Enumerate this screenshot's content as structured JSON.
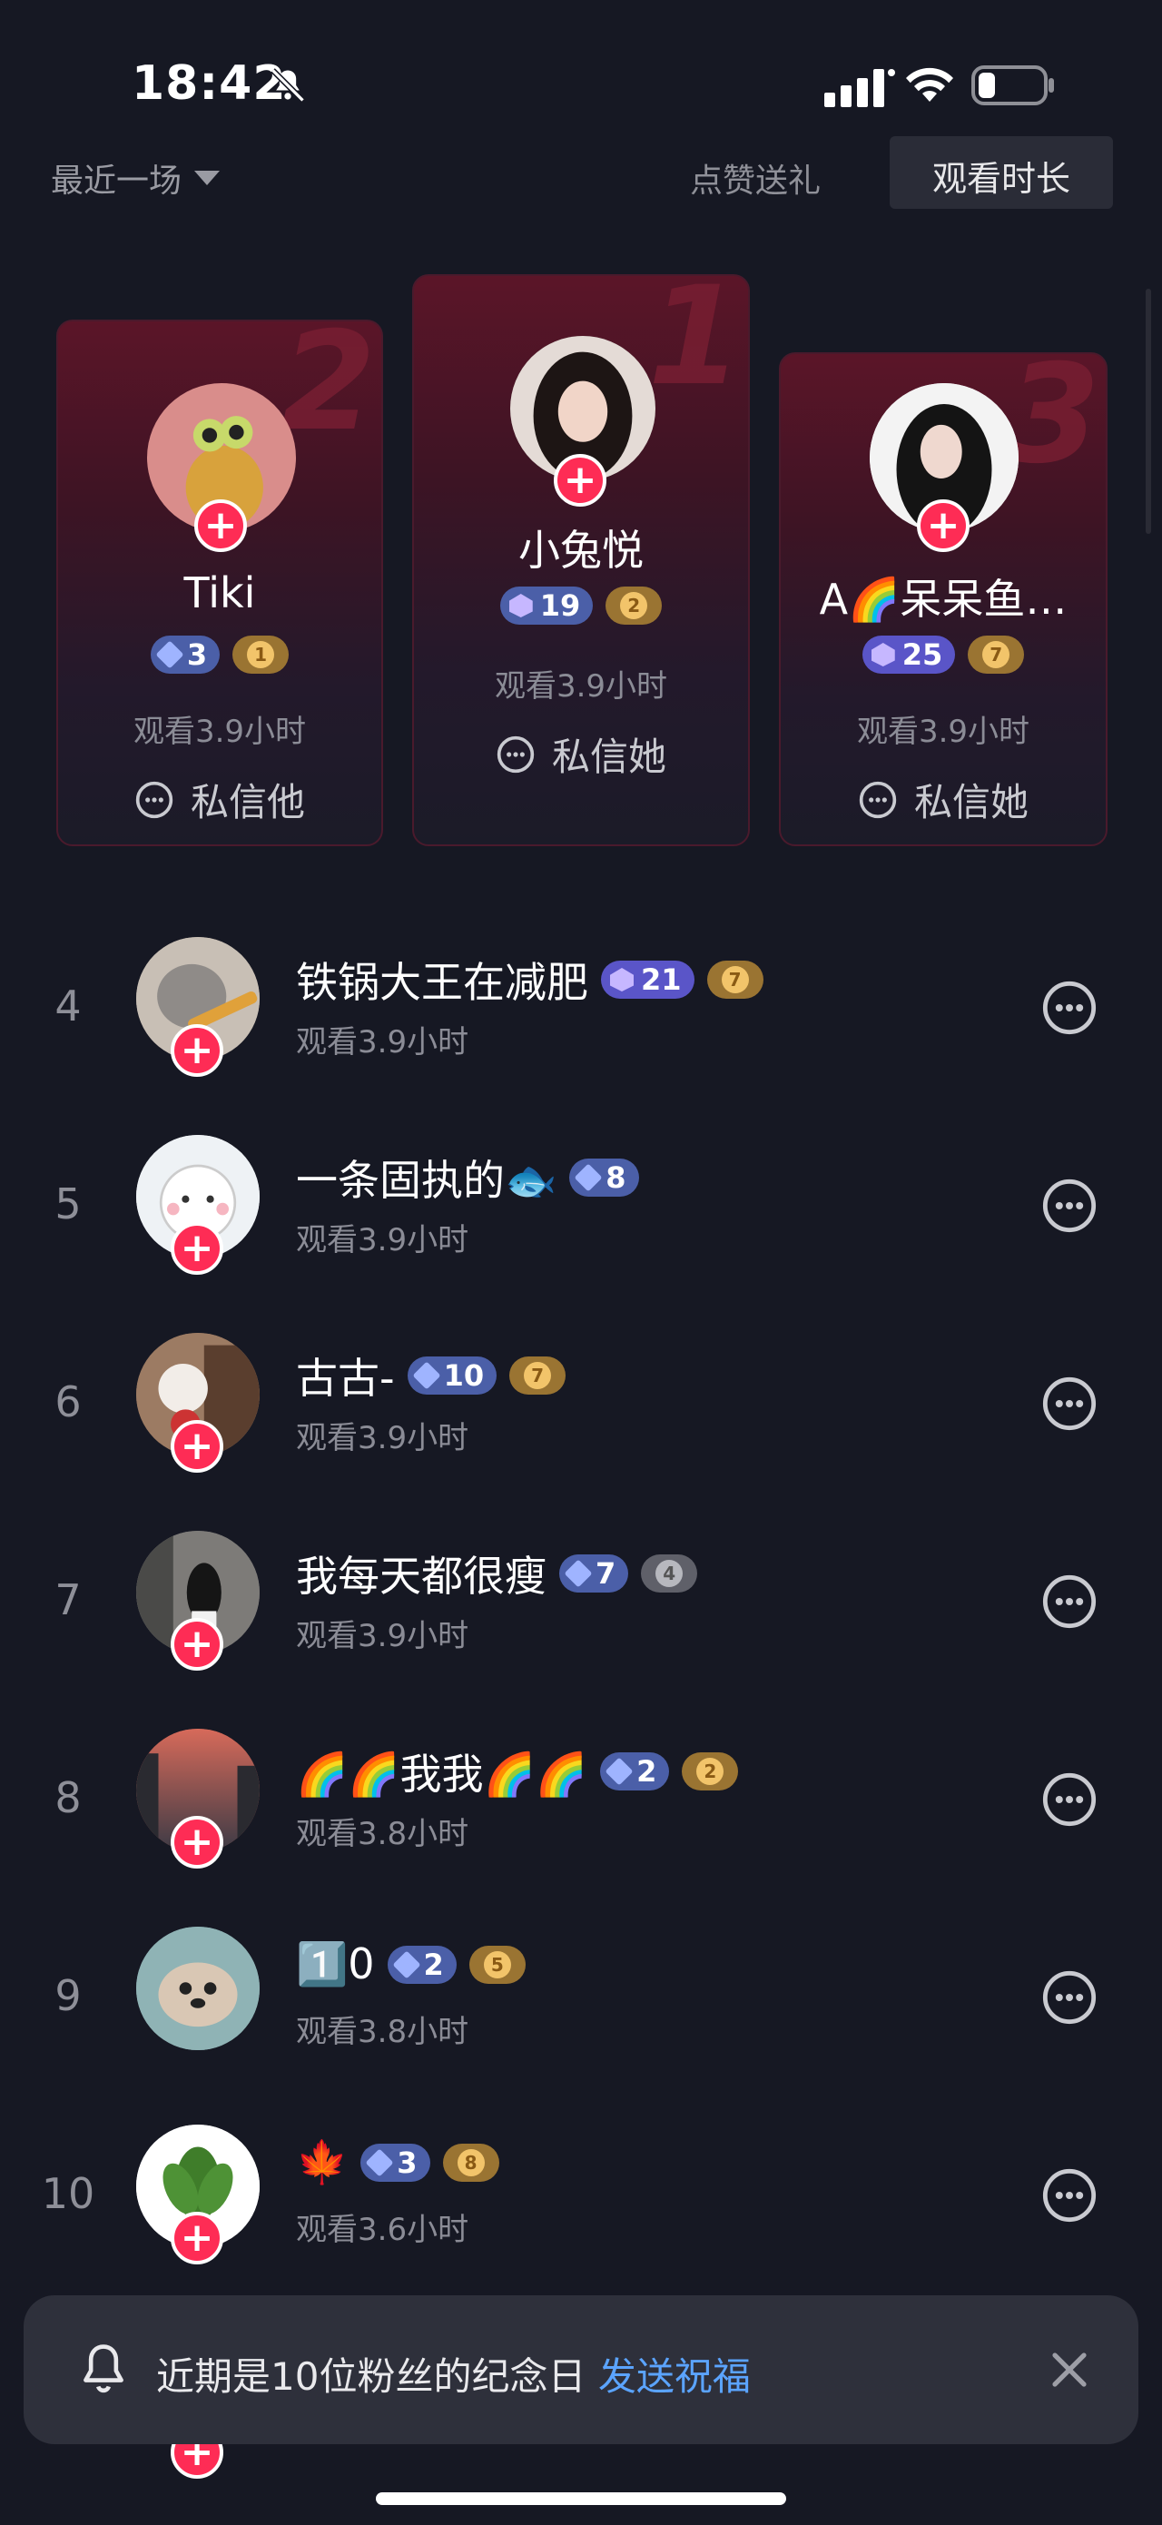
{
  "status": {
    "time": "18:42"
  },
  "filter": {
    "range": "最近一场",
    "tab_like": "点赞送礼",
    "tab_watch": "观看时长"
  },
  "podium": [
    {
      "rank": "2",
      "name": "Tiki",
      "level": "3",
      "fan_level": "1",
      "watch": "观看3.9小时",
      "dm": "私信他"
    },
    {
      "rank": "1",
      "name": "小兔悦",
      "level": "19",
      "fan_level": "2",
      "watch": "观看3.9小时",
      "dm": "私信她"
    },
    {
      "rank": "3",
      "name": "A🌈呆呆鱼…",
      "level": "25",
      "fan_level": "7",
      "watch": "观看3.9小时",
      "dm": "私信她"
    }
  ],
  "list": [
    {
      "rank": "4",
      "name": "铁锅大王在减肥",
      "level": "21",
      "fan_level": "7",
      "watch": "观看3.9小时"
    },
    {
      "rank": "5",
      "name": "一条固执的🐟",
      "level": "8",
      "fan_level": "",
      "watch": "观看3.9小时"
    },
    {
      "rank": "6",
      "name": "古古-",
      "level": "10",
      "fan_level": "7",
      "watch": "观看3.9小时"
    },
    {
      "rank": "7",
      "name": "我每天都很瘦",
      "level": "7",
      "fan_level": "4",
      "watch": "观看3.9小时"
    },
    {
      "rank": "8",
      "name": "🌈🌈我我🌈🌈",
      "level": "2",
      "fan_level": "2",
      "watch": "观看3.8小时"
    },
    {
      "rank": "9",
      "name": "1️⃣0",
      "level": "2",
      "fan_level": "5",
      "watch": "观看3.8小时"
    },
    {
      "rank": "10",
      "name": "🍁",
      "level": "3",
      "fan_level": "8",
      "watch": "观看3.6小时"
    }
  ],
  "toast": {
    "text": "近期是10位粉丝的纪念日",
    "link": "发送祝福"
  },
  "icons": {
    "bell_off": "bell-slash-icon",
    "signal": "cellular-signal-icon",
    "wifi": "wifi-icon",
    "battery": "battery-icon",
    "dropdown": "triangle-down-icon",
    "chat": "chat-bubble-icon",
    "plus": "plus-icon",
    "level": "diamond-icon",
    "fan": "heart-icon",
    "bell": "bell-icon",
    "close": "close-icon"
  },
  "colors": {
    "background": "#161823",
    "accent_red": "#fe2c55",
    "link_blue": "#5ba4ff",
    "level_badge": "#4b5fa8",
    "fan_badge": "#9a7432"
  }
}
